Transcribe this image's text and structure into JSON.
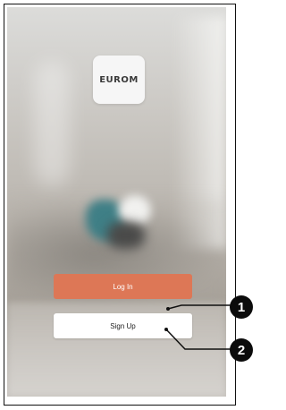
{
  "app": {
    "logo_text": "EUROM"
  },
  "buttons": {
    "login_label": "Log In",
    "signup_label": "Sign Up"
  },
  "callouts": [
    {
      "number": "1"
    },
    {
      "number": "2"
    }
  ],
  "colors": {
    "login_button": "#dd7756",
    "signup_button": "#ffffff",
    "badge": "#0b0b0b"
  }
}
